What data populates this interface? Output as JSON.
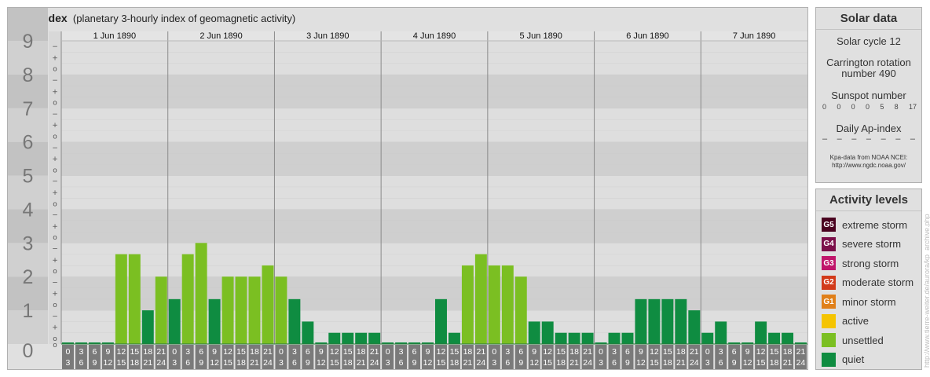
{
  "header": {
    "title": "Kpa-index",
    "subtitle": "(planetary 3-hourly index of geomagnetic activity)"
  },
  "chart_data": {
    "type": "bar",
    "title": "Kpa-index",
    "subtitle": "(planetary 3-hourly index of geomagnetic activity)",
    "ylim": [
      0,
      9
    ],
    "y_ticks": [
      "0",
      "1",
      "2",
      "3",
      "4",
      "5",
      "6",
      "7",
      "8",
      "9"
    ],
    "y_subticks": [
      "o",
      "+",
      "−"
    ],
    "days": [
      "1 Jun 1890",
      "2 Jun 1890",
      "3 Jun 1890",
      "4 Jun 1890",
      "5 Jun 1890",
      "6 Jun 1890",
      "7 Jun 1890"
    ],
    "interval_start": [
      "0",
      "3",
      "6",
      "9",
      "12",
      "15",
      "18",
      "21"
    ],
    "interval_end": [
      "3",
      "6",
      "9",
      "12",
      "15",
      "18",
      "21",
      "24"
    ],
    "values": [
      0,
      0,
      0,
      0,
      2.667,
      2.667,
      1,
      2,
      1.333,
      2.667,
      3,
      1.333,
      2,
      2,
      2,
      2.333,
      2,
      1.333,
      0.667,
      0,
      0.333,
      0.333,
      0.333,
      0.333,
      0,
      0,
      0,
      0,
      1.333,
      0.333,
      2.333,
      2.667,
      2.333,
      2.333,
      2,
      0.667,
      0.667,
      0.333,
      0.333,
      0.333,
      0,
      0.333,
      0.333,
      1.333,
      1.333,
      1.333,
      1.333,
      1,
      0.333,
      0.667,
      0,
      0,
      0.667,
      0.333,
      0.333,
      0
    ],
    "grid": true
  },
  "colors": {
    "quiet": "#0f8c41",
    "unsettled": "#7bbf22",
    "active": "#f5c400",
    "minor": "#e0801a",
    "moderate": "#d23a1a",
    "strong": "#c0166b",
    "severe": "#7c0f4a",
    "extreme": "#4a0220"
  },
  "solar": {
    "title": "Solar data",
    "cycle": "Solar cycle 12",
    "carrington_line1": "Carrington rotation",
    "carrington_line2": "number 490",
    "sunspot_label": "Sunspot number",
    "sunspot_values": [
      "0",
      "0",
      "0",
      "0",
      "5",
      "8",
      "17"
    ],
    "ap_label": "Daily Ap-index",
    "ap_values": [
      "–",
      "–",
      "–",
      "–",
      "–",
      "–",
      "–"
    ],
    "source_line1": "Kpa-data from NOAA NCEI:",
    "source_line2": "http://www.ngdc.noaa.gov/"
  },
  "activity": {
    "title": "Activity levels",
    "levels": [
      {
        "badge": "G5",
        "label": "extreme storm",
        "color": "#4a0220"
      },
      {
        "badge": "G4",
        "label": "severe storm",
        "color": "#7c0f4a"
      },
      {
        "badge": "G3",
        "label": "strong storm",
        "color": "#c0166b"
      },
      {
        "badge": "G2",
        "label": "moderate storm",
        "color": "#d23a1a"
      },
      {
        "badge": "G1",
        "label": "minor storm",
        "color": "#e0801a"
      },
      {
        "badge": "",
        "label": "active",
        "color": "#f5c400"
      },
      {
        "badge": "",
        "label": "unsettled",
        "color": "#7bbf22"
      },
      {
        "badge": "",
        "label": "quiet",
        "color": "#0f8c41"
      }
    ]
  },
  "credit": "http://www.tierre-weiter.de/aurora/kp_archive.php"
}
